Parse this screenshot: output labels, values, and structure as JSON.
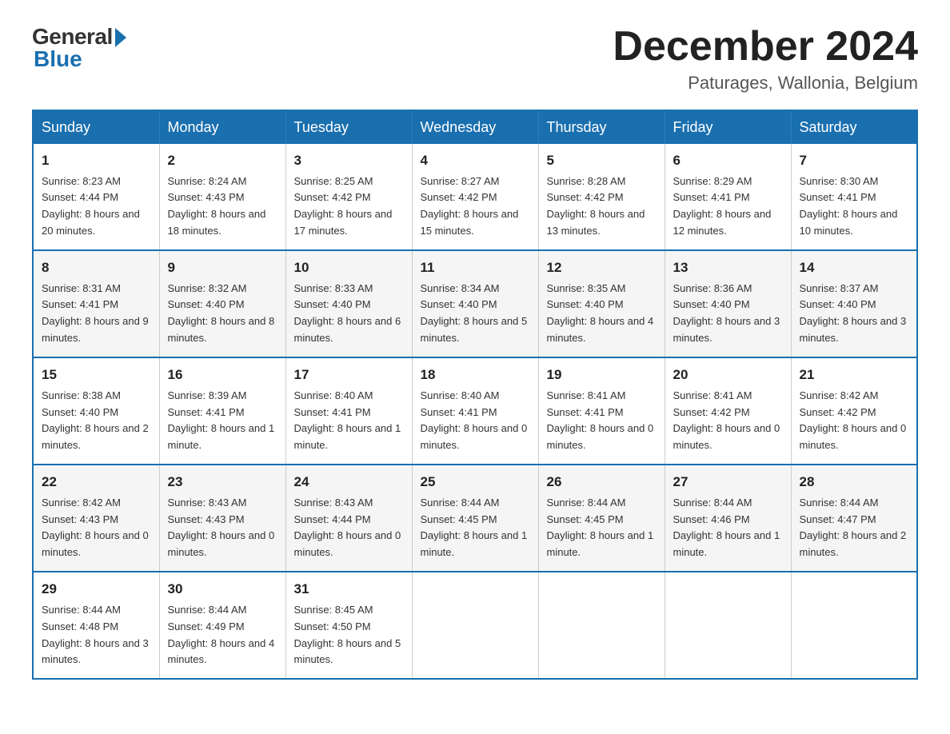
{
  "header": {
    "logo_general": "General",
    "logo_blue": "Blue",
    "month_title": "December 2024",
    "location": "Paturages, Wallonia, Belgium"
  },
  "days_of_week": [
    "Sunday",
    "Monday",
    "Tuesday",
    "Wednesday",
    "Thursday",
    "Friday",
    "Saturday"
  ],
  "weeks": [
    [
      {
        "num": "1",
        "sunrise": "8:23 AM",
        "sunset": "4:44 PM",
        "daylight": "8 hours and 20 minutes."
      },
      {
        "num": "2",
        "sunrise": "8:24 AM",
        "sunset": "4:43 PM",
        "daylight": "8 hours and 18 minutes."
      },
      {
        "num": "3",
        "sunrise": "8:25 AM",
        "sunset": "4:42 PM",
        "daylight": "8 hours and 17 minutes."
      },
      {
        "num": "4",
        "sunrise": "8:27 AM",
        "sunset": "4:42 PM",
        "daylight": "8 hours and 15 minutes."
      },
      {
        "num": "5",
        "sunrise": "8:28 AM",
        "sunset": "4:42 PM",
        "daylight": "8 hours and 13 minutes."
      },
      {
        "num": "6",
        "sunrise": "8:29 AM",
        "sunset": "4:41 PM",
        "daylight": "8 hours and 12 minutes."
      },
      {
        "num": "7",
        "sunrise": "8:30 AM",
        "sunset": "4:41 PM",
        "daylight": "8 hours and 10 minutes."
      }
    ],
    [
      {
        "num": "8",
        "sunrise": "8:31 AM",
        "sunset": "4:41 PM",
        "daylight": "8 hours and 9 minutes."
      },
      {
        "num": "9",
        "sunrise": "8:32 AM",
        "sunset": "4:40 PM",
        "daylight": "8 hours and 8 minutes."
      },
      {
        "num": "10",
        "sunrise": "8:33 AM",
        "sunset": "4:40 PM",
        "daylight": "8 hours and 6 minutes."
      },
      {
        "num": "11",
        "sunrise": "8:34 AM",
        "sunset": "4:40 PM",
        "daylight": "8 hours and 5 minutes."
      },
      {
        "num": "12",
        "sunrise": "8:35 AM",
        "sunset": "4:40 PM",
        "daylight": "8 hours and 4 minutes."
      },
      {
        "num": "13",
        "sunrise": "8:36 AM",
        "sunset": "4:40 PM",
        "daylight": "8 hours and 3 minutes."
      },
      {
        "num": "14",
        "sunrise": "8:37 AM",
        "sunset": "4:40 PM",
        "daylight": "8 hours and 3 minutes."
      }
    ],
    [
      {
        "num": "15",
        "sunrise": "8:38 AM",
        "sunset": "4:40 PM",
        "daylight": "8 hours and 2 minutes."
      },
      {
        "num": "16",
        "sunrise": "8:39 AM",
        "sunset": "4:41 PM",
        "daylight": "8 hours and 1 minute."
      },
      {
        "num": "17",
        "sunrise": "8:40 AM",
        "sunset": "4:41 PM",
        "daylight": "8 hours and 1 minute."
      },
      {
        "num": "18",
        "sunrise": "8:40 AM",
        "sunset": "4:41 PM",
        "daylight": "8 hours and 0 minutes."
      },
      {
        "num": "19",
        "sunrise": "8:41 AM",
        "sunset": "4:41 PM",
        "daylight": "8 hours and 0 minutes."
      },
      {
        "num": "20",
        "sunrise": "8:41 AM",
        "sunset": "4:42 PM",
        "daylight": "8 hours and 0 minutes."
      },
      {
        "num": "21",
        "sunrise": "8:42 AM",
        "sunset": "4:42 PM",
        "daylight": "8 hours and 0 minutes."
      }
    ],
    [
      {
        "num": "22",
        "sunrise": "8:42 AM",
        "sunset": "4:43 PM",
        "daylight": "8 hours and 0 minutes."
      },
      {
        "num": "23",
        "sunrise": "8:43 AM",
        "sunset": "4:43 PM",
        "daylight": "8 hours and 0 minutes."
      },
      {
        "num": "24",
        "sunrise": "8:43 AM",
        "sunset": "4:44 PM",
        "daylight": "8 hours and 0 minutes."
      },
      {
        "num": "25",
        "sunrise": "8:44 AM",
        "sunset": "4:45 PM",
        "daylight": "8 hours and 1 minute."
      },
      {
        "num": "26",
        "sunrise": "8:44 AM",
        "sunset": "4:45 PM",
        "daylight": "8 hours and 1 minute."
      },
      {
        "num": "27",
        "sunrise": "8:44 AM",
        "sunset": "4:46 PM",
        "daylight": "8 hours and 1 minute."
      },
      {
        "num": "28",
        "sunrise": "8:44 AM",
        "sunset": "4:47 PM",
        "daylight": "8 hours and 2 minutes."
      }
    ],
    [
      {
        "num": "29",
        "sunrise": "8:44 AM",
        "sunset": "4:48 PM",
        "daylight": "8 hours and 3 minutes."
      },
      {
        "num": "30",
        "sunrise": "8:44 AM",
        "sunset": "4:49 PM",
        "daylight": "8 hours and 4 minutes."
      },
      {
        "num": "31",
        "sunrise": "8:45 AM",
        "sunset": "4:50 PM",
        "daylight": "8 hours and 5 minutes."
      },
      null,
      null,
      null,
      null
    ]
  ]
}
